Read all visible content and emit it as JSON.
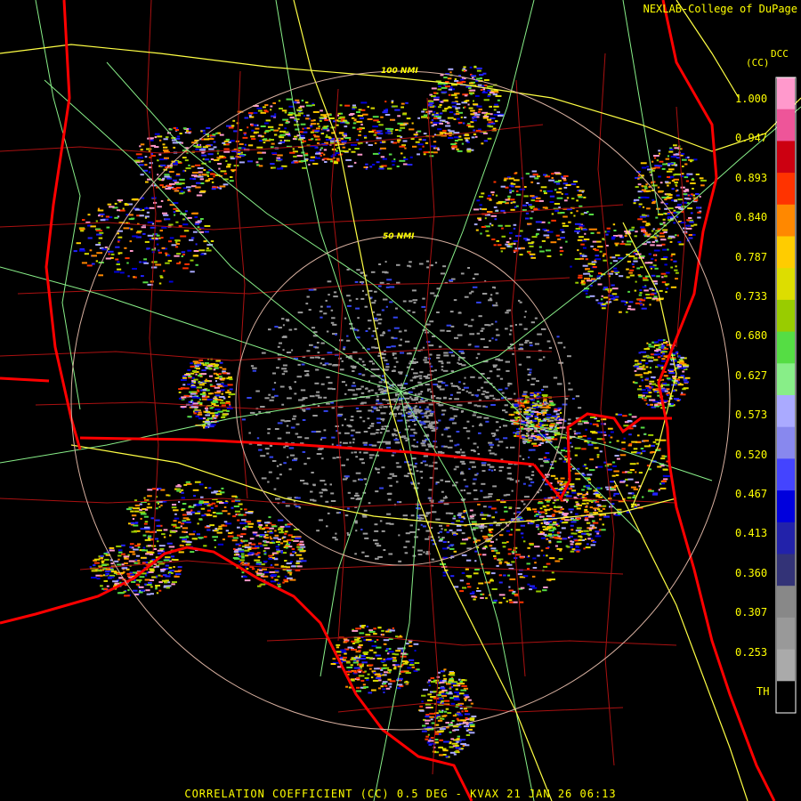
{
  "credit": "NEXLAB-College of DuPage",
  "footer": "CORRELATION COEFFICIENT (CC) 0.5 DEG - KVAX 21 JAN 26 06:13",
  "legend": {
    "product_code": "DCC",
    "unit_code": "(CC)",
    "ticks": [
      "1.000",
      "0.947",
      "0.893",
      "0.840",
      "0.787",
      "0.733",
      "0.680",
      "0.627",
      "0.573",
      "0.520",
      "0.467",
      "0.413",
      "0.360",
      "0.307",
      "0.253",
      "TH"
    ],
    "colors": [
      "#ff99cc",
      "#ee5599",
      "#cc0011",
      "#ff3300",
      "#ff8800",
      "#ffcc00",
      "#dddd00",
      "#99cc00",
      "#55dd44",
      "#88ee88",
      "#aaaaff",
      "#8888ee",
      "#4444ff",
      "#0000dd",
      "#2222aa",
      "#333377",
      "#888888",
      "#999999",
      "#aaaaaa",
      "#000000"
    ]
  },
  "range_rings": {
    "inner_label": "50 NMI",
    "outer_label": "100 NMI"
  },
  "colors": {
    "state_border": "#ff0000",
    "county_border": "#aa1111",
    "highway": "#ffff44",
    "road": "#88ee88",
    "ring": "#d8b0a0",
    "text": "#ffff00"
  }
}
